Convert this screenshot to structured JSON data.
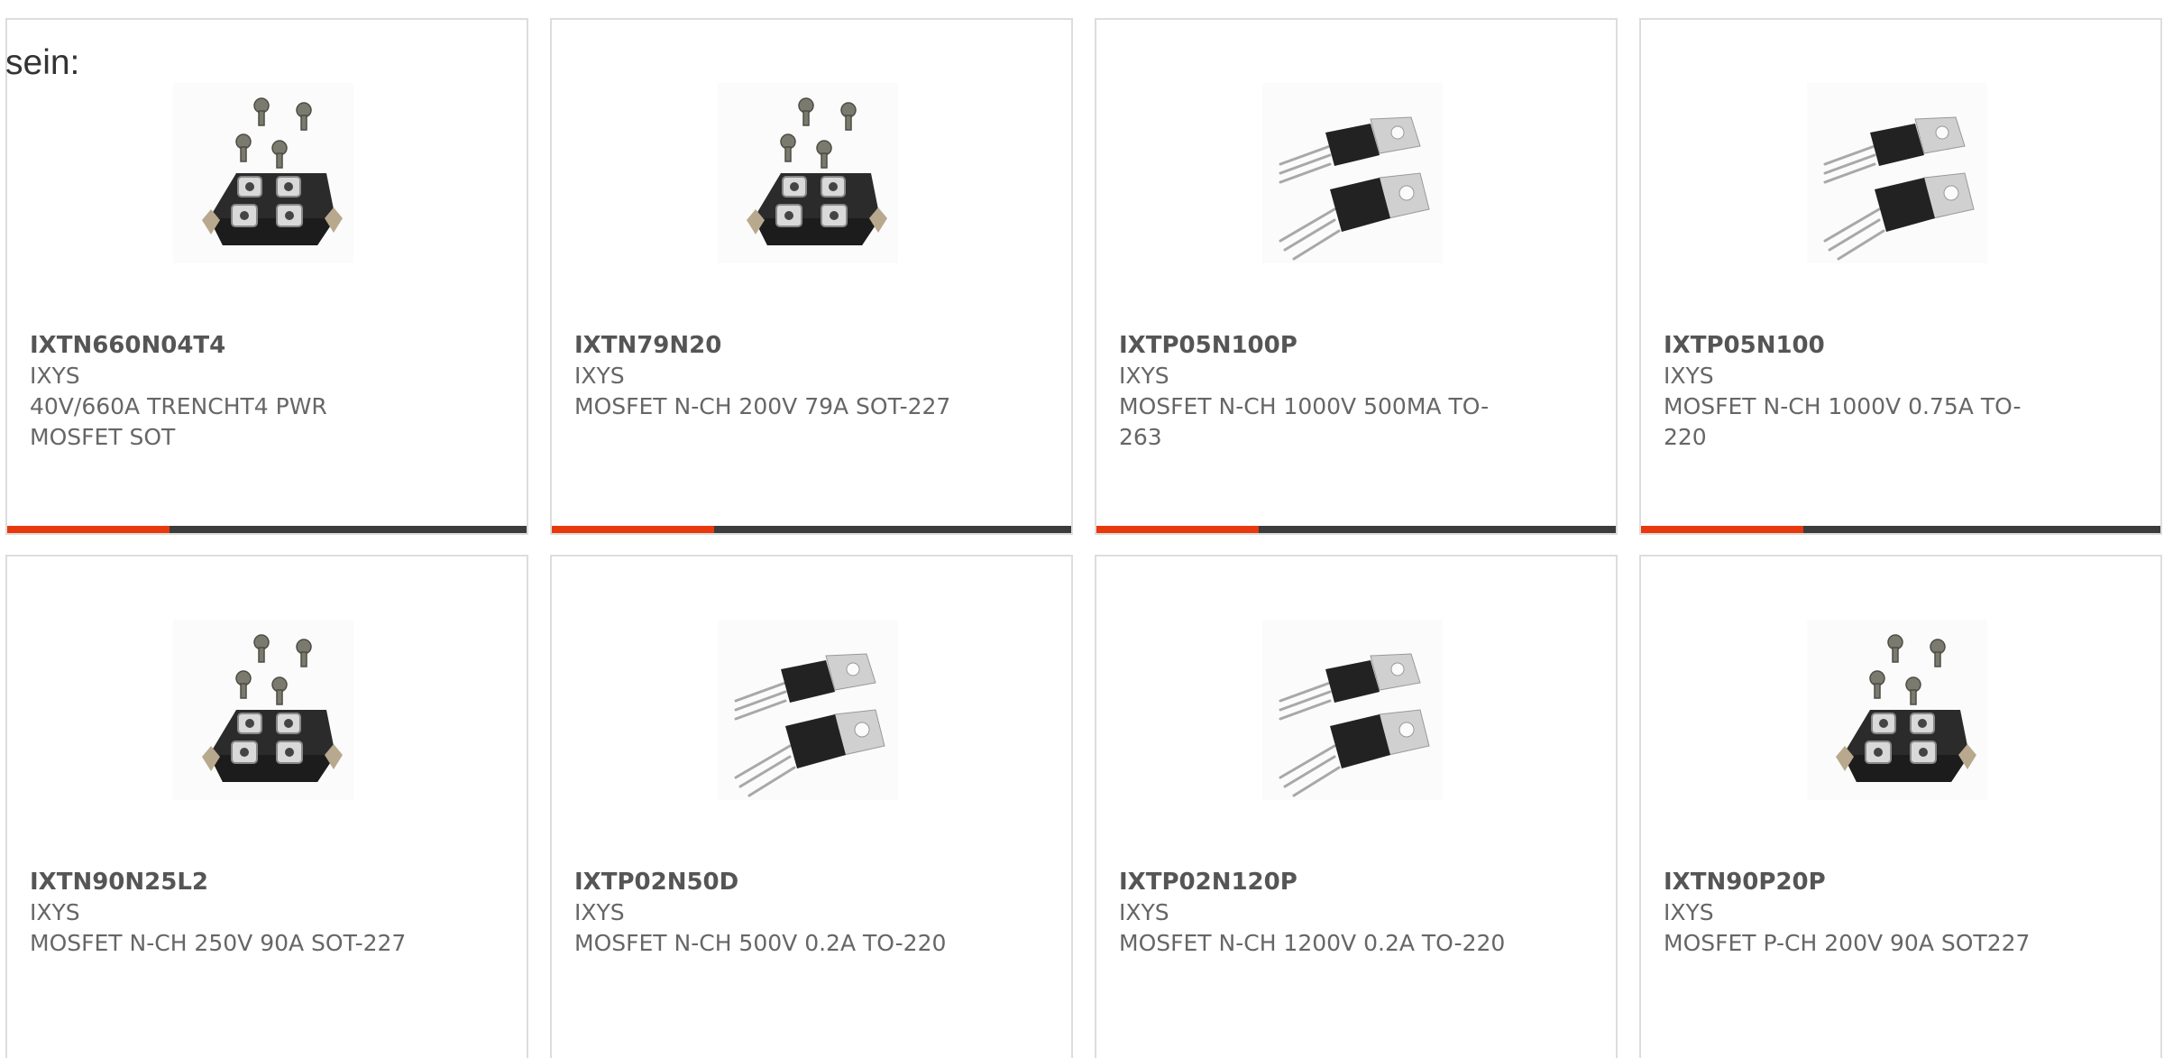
{
  "intro_text": "sein:",
  "colors": {
    "accent": "#e8380d",
    "bar": "#3c3c3c",
    "border": "#dddddd"
  },
  "products": [
    {
      "part_number": "IXTN660N04T4",
      "manufacturer": "IXYS",
      "description": "40V/660A TRENCHT4 PWR MOSFET SOT",
      "image": "sot-227-module-icon"
    },
    {
      "part_number": "IXTN79N20",
      "manufacturer": "IXYS",
      "description": "MOSFET N-CH 200V 79A SOT-227",
      "image": "sot-227-module-icon"
    },
    {
      "part_number": "IXTP05N100P",
      "manufacturer": "IXYS",
      "description": "MOSFET N-CH 1000V 500MA TO-263",
      "image": "to-220-transistor-icon"
    },
    {
      "part_number": "IXTP05N100",
      "manufacturer": "IXYS",
      "description": "MOSFET N-CH 1000V 0.75A TO-220",
      "image": "to-220-transistor-icon"
    },
    {
      "part_number": "IXTN90N25L2",
      "manufacturer": "IXYS",
      "description": "MOSFET N-CH 250V 90A SOT-227",
      "image": "sot-227-module-icon"
    },
    {
      "part_number": "IXTP02N50D",
      "manufacturer": "IXYS",
      "description": "MOSFET N-CH 500V 0.2A TO-220",
      "image": "to-220-transistor-icon"
    },
    {
      "part_number": "IXTP02N120P",
      "manufacturer": "IXYS",
      "description": "MOSFET N-CH 1200V 0.2A TO-220",
      "image": "to-220-transistor-icon"
    },
    {
      "part_number": "IXTN90P20P",
      "manufacturer": "IXYS",
      "description": "MOSFET P-CH 200V 90A SOT227",
      "image": "sot-227-module-icon"
    }
  ]
}
